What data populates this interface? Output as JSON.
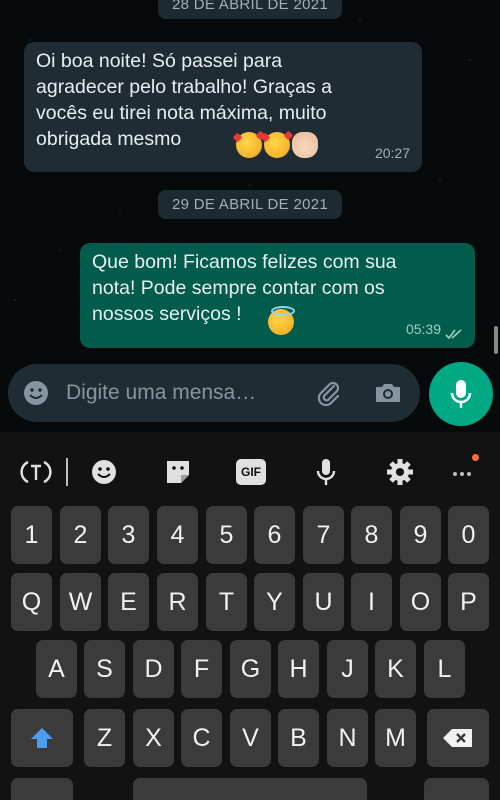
{
  "chat": {
    "date_chips": [
      "28 DE ABRIL DE 2021",
      "29 DE ABRIL DE 2021"
    ],
    "messages": [
      {
        "direction": "incoming",
        "text": "Oi boa noite! Só passei para\nagradecer pelo trabalho! Graças a\nvocês eu tirei nota máxima, muito\nobrigada mesmo",
        "emojis": [
          "smiling-face-with-hearts-icon",
          "smiling-face-with-hearts-icon",
          "clapping-hands-icon"
        ],
        "time": "20:27"
      },
      {
        "direction": "outgoing",
        "text": "Que bom! Ficamos felizes com sua\nnota! Pode sempre contar com os\nnossos serviços !",
        "emojis": [
          "smiling-face-with-halo-icon"
        ],
        "time": "05:39",
        "status": "read-double-check-icon"
      }
    ]
  },
  "input": {
    "placeholder": "Digite uma mensa…"
  },
  "keyboard": {
    "toolbar": [
      "text-cursor-icon",
      "emoji-icon",
      "sticker-icon",
      "gif-icon",
      "mic-icon",
      "settings-gear-icon",
      "more-icon"
    ],
    "gif_label": "GIF",
    "row_numbers": [
      "1",
      "2",
      "3",
      "4",
      "5",
      "6",
      "7",
      "8",
      "9",
      "0"
    ],
    "row_1": [
      "Q",
      "W",
      "E",
      "R",
      "T",
      "Y",
      "U",
      "I",
      "O",
      "P"
    ],
    "row_2": [
      "A",
      "S",
      "D",
      "F",
      "G",
      "H",
      "J",
      "K",
      "L"
    ],
    "row_3": [
      "Z",
      "X",
      "C",
      "V",
      "B",
      "N",
      "M"
    ]
  },
  "colors": {
    "accent": "#00a884",
    "outgoing_bubble": "#025c4b",
    "incoming_bubble": "#1f2c33",
    "shift_blue": "#4a9ef0"
  }
}
